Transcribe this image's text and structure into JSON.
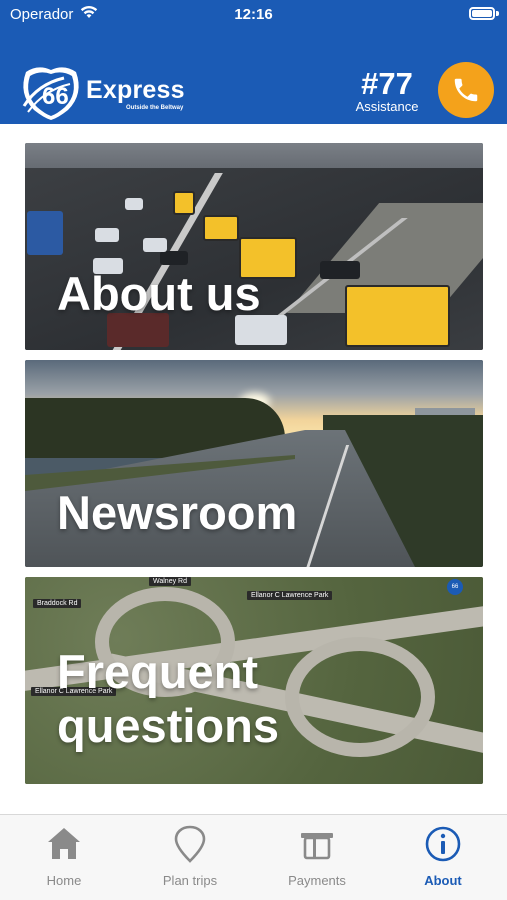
{
  "status_bar": {
    "carrier": "Operador",
    "time": "12:16"
  },
  "header": {
    "logo": {
      "shield_text": "66",
      "word": "Express",
      "tagline": "Outside the Beltway"
    },
    "assistance": {
      "number": "#77",
      "label": "Assistance"
    },
    "call_icon": "phone-icon"
  },
  "cards": [
    {
      "label": "About us",
      "image": "highway-traffic-buses"
    },
    {
      "label": "Newsroom",
      "image": "highway-sunset"
    },
    {
      "label": "Frequent questions",
      "image": "interchange-aerial"
    }
  ],
  "faq_signs": {
    "sign1": "Braddock Rd",
    "sign2": "Walney Rd",
    "sign3": "Ellanor C Lawrence Park",
    "sign4": "Ellanor C Lawrence Park",
    "route": "66"
  },
  "tabbar": {
    "items": [
      {
        "label": "Home",
        "icon": "home-icon"
      },
      {
        "label": "Plan trips",
        "icon": "map-pin-icon"
      },
      {
        "label": "Payments",
        "icon": "toll-payment-icon"
      },
      {
        "label": "About",
        "icon": "info-icon"
      }
    ],
    "active": "About"
  },
  "colors": {
    "brand_blue": "#1b5bb5",
    "call_orange": "#f4a21b",
    "tab_inactive": "#8a8a8a"
  }
}
